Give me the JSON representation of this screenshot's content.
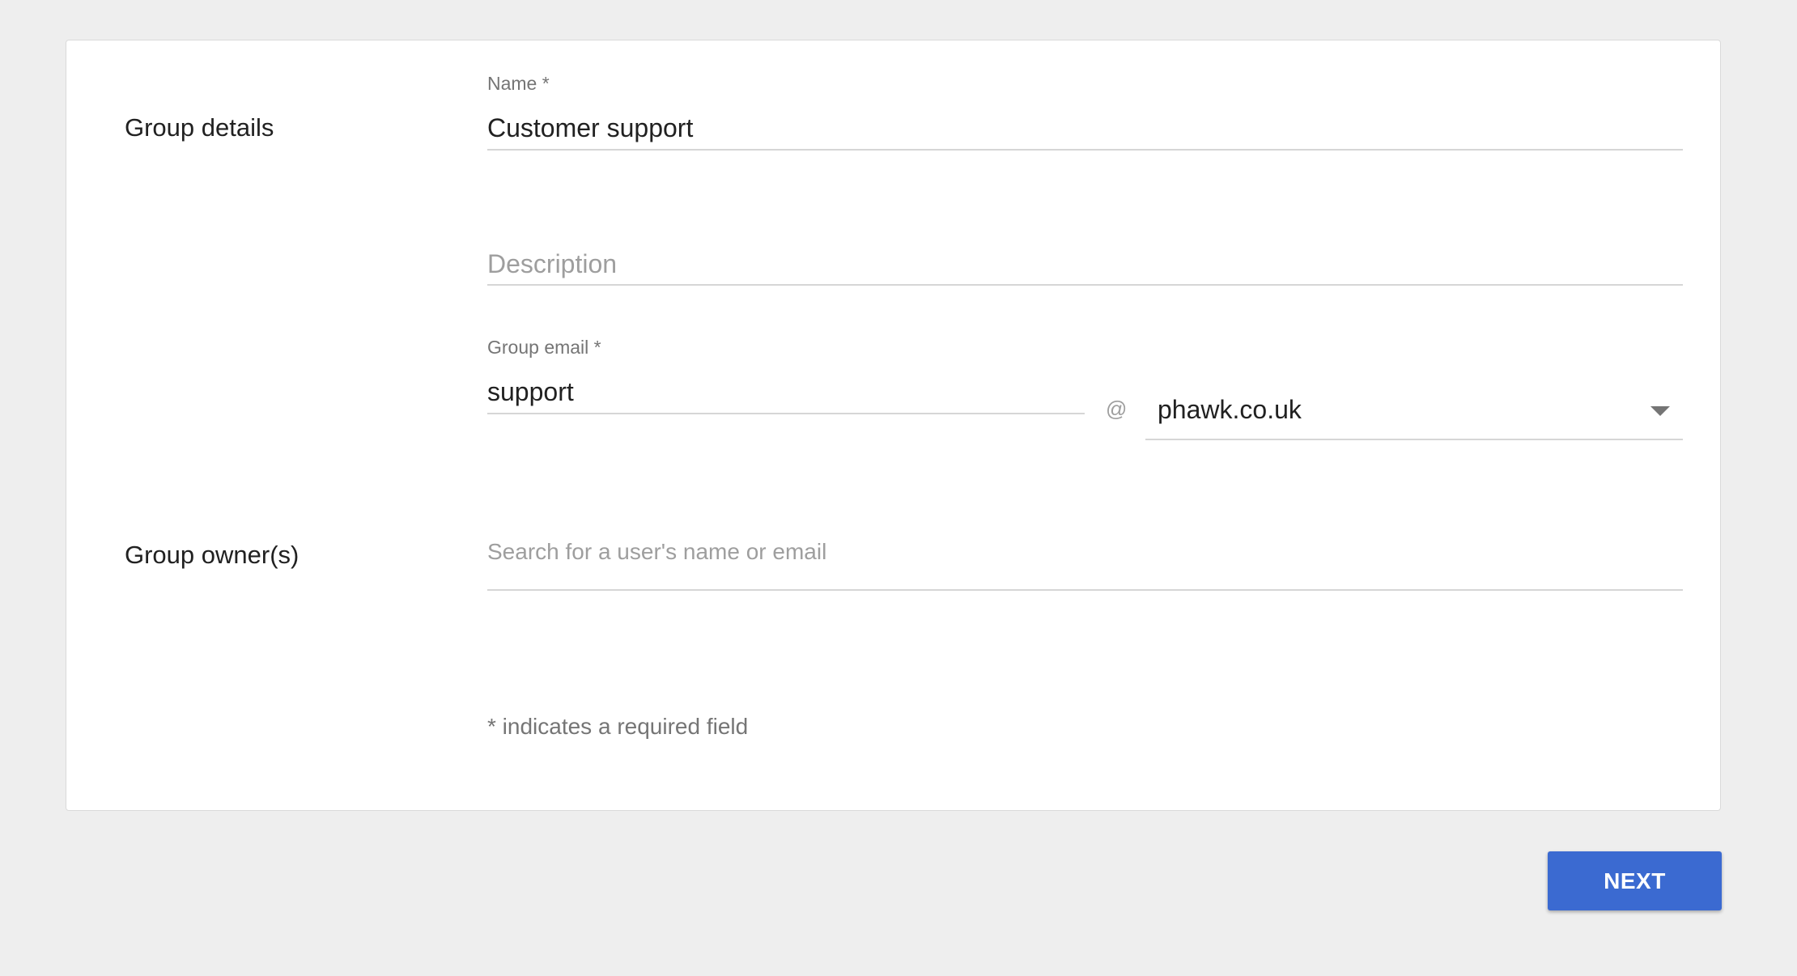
{
  "group_details": {
    "section_label": "Group details",
    "name": {
      "label": "Name *",
      "value": "Customer support"
    },
    "description": {
      "placeholder": "Description"
    },
    "group_email": {
      "label": "Group email *",
      "value": "support",
      "at_symbol": "@",
      "domain": "phawk.co.uk"
    }
  },
  "group_owners": {
    "section_label": "Group owner(s)",
    "search": {
      "placeholder": "Search for a user's name or email"
    }
  },
  "footer": {
    "required_note": "* indicates a required field"
  },
  "actions": {
    "next_label": "NEXT"
  },
  "colors": {
    "background": "#eeeeee",
    "card": "#ffffff",
    "primary_button": "#3b6ad1"
  }
}
